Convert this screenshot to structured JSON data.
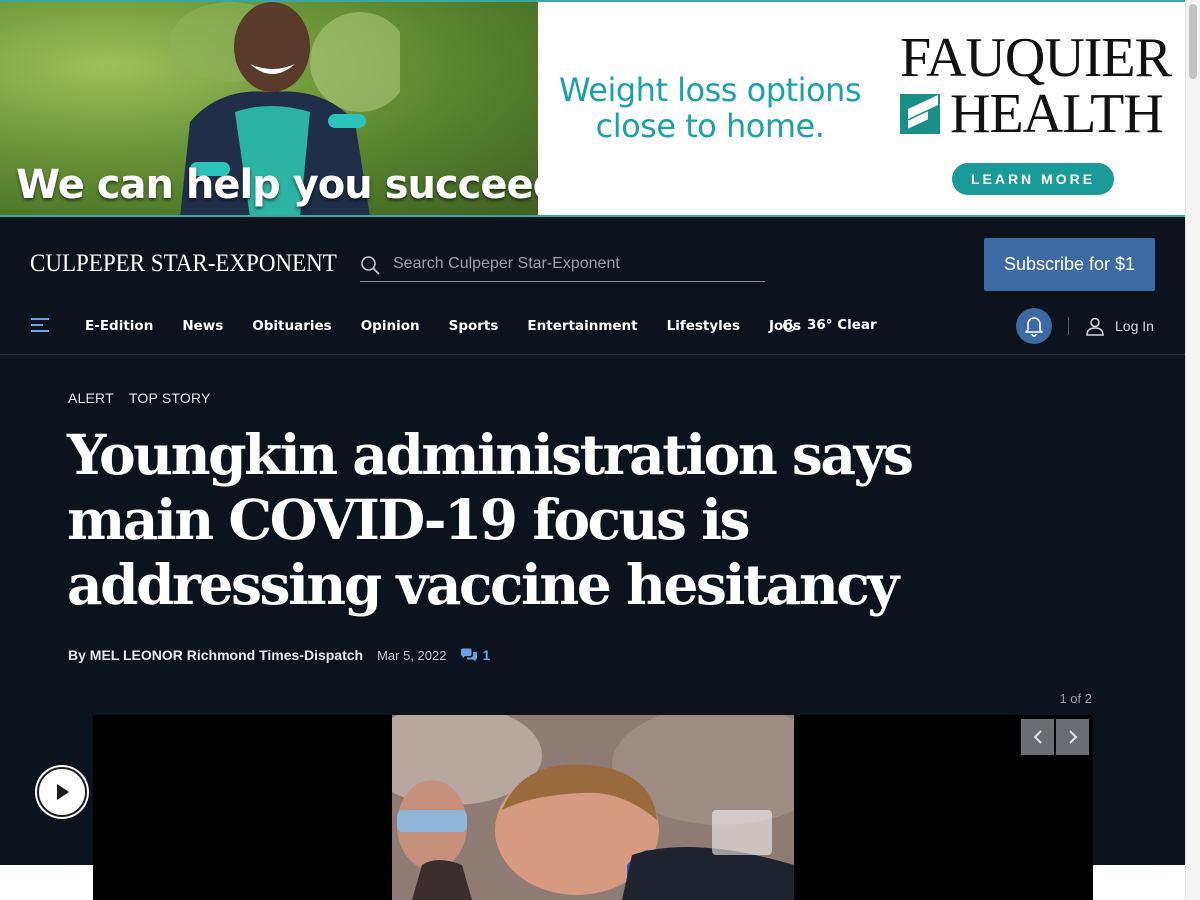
{
  "ad": {
    "slogan": "We can help you succeed.",
    "copy": "Weight loss options close to home.",
    "brand_line1": "FAUQUIER",
    "brand_line2": "HEALTH",
    "cta": "LEARN MORE",
    "accent_color": "#1a9a98"
  },
  "header": {
    "masthead": "CULPEPER STAR-EXPONENT",
    "search_placeholder": "Search Culpeper Star-Exponent",
    "subscribe_label": "Subscribe for $1"
  },
  "nav": {
    "items": [
      "E-Edition",
      "News",
      "Obituaries",
      "Opinion",
      "Sports",
      "Entertainment",
      "Lifestyles",
      "Jobs"
    ],
    "weather": "36° Clear",
    "login_label": "Log In"
  },
  "article": {
    "kickers": [
      "ALERT",
      "TOP STORY"
    ],
    "headline": "Youngkin administration says main COVID-19 focus is addressing vaccine hesitancy",
    "byline": "By MEL LEONOR Richmond Times-Dispatch",
    "date": "Mar 5, 2022",
    "comment_count": "1",
    "slide_count": "1 of 2"
  },
  "colors": {
    "header_bg": "#0d131d",
    "subscribe_bg": "#3e6aa3",
    "link_blue": "#6ea0e0"
  }
}
